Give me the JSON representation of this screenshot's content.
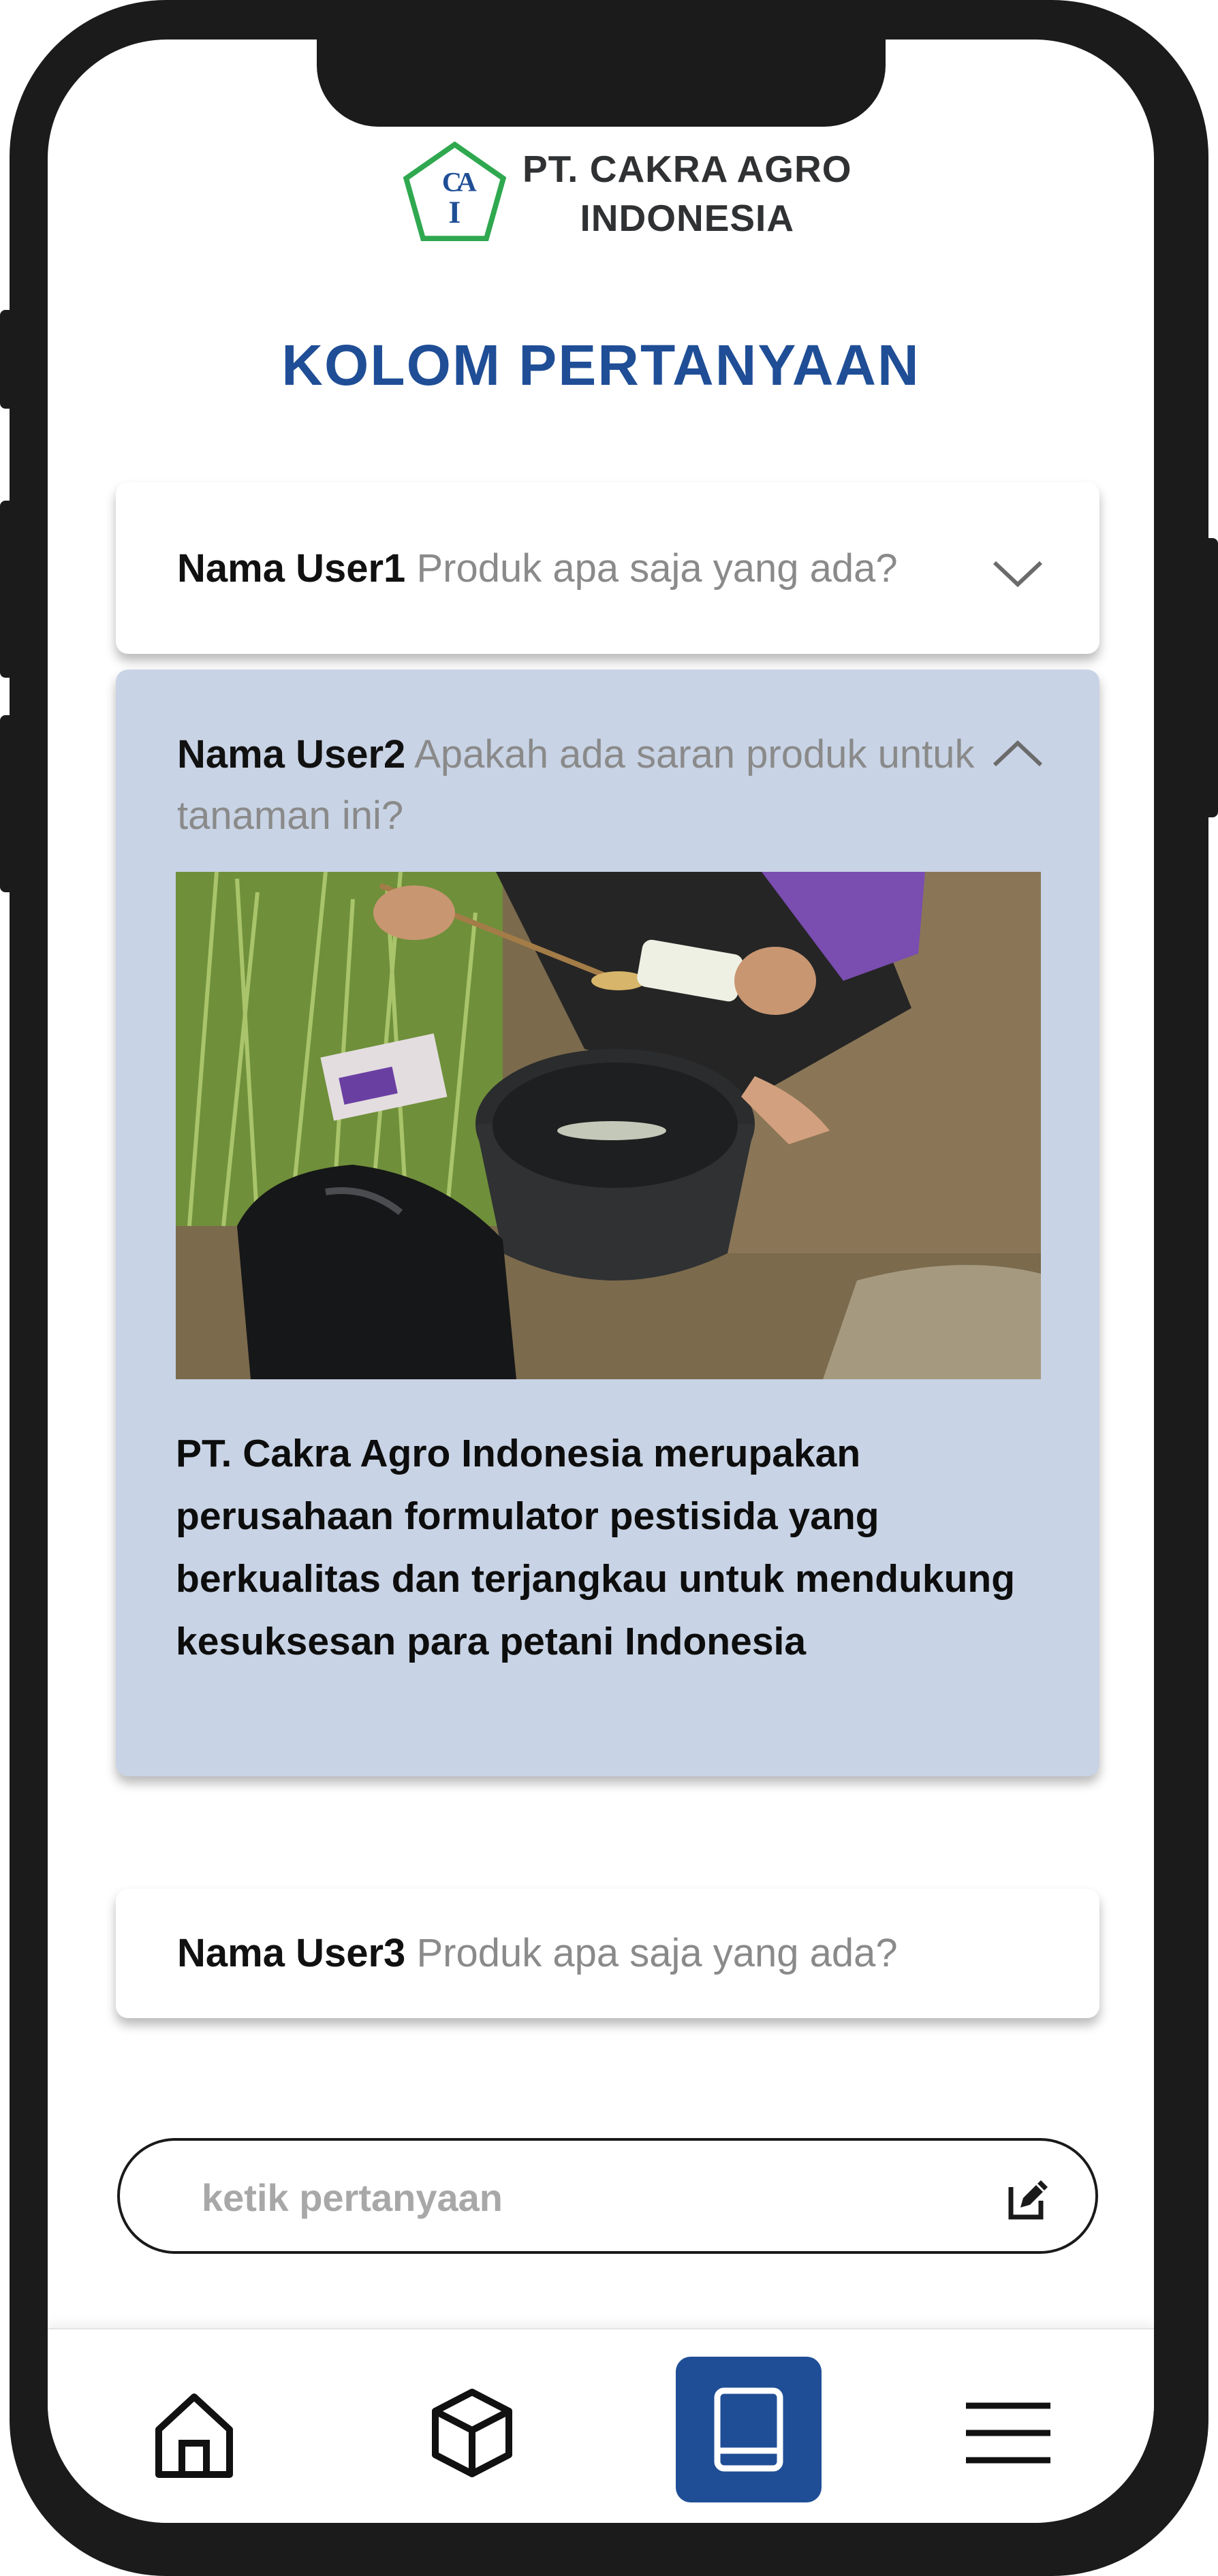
{
  "brand": {
    "name_line1": "PT. CAKRA AGRO",
    "name_line2": "INDONESIA",
    "logo_text": "CAI",
    "logo_color": "#2fa84f"
  },
  "page": {
    "title": "KOLOM PERTANYAAN",
    "title_color": "#1f4e96"
  },
  "questions": [
    {
      "user": "Nama User1",
      "text": "Produk apa saja yang ada?",
      "expanded": false,
      "chevron_icon": "chevron-down-icon"
    },
    {
      "user": "Nama User2",
      "text": "Apakah ada saran produk untuk tanaman ini?",
      "expanded": true,
      "chevron_icon": "chevron-up-icon",
      "photo_icon": "farmer-mixing-pesticide-photo",
      "answer": "PT. Cakra Agro Indonesia merupakan perusahaan formulator pestisida yang berkualitas dan terjangkau untuk mendukung kesuksesan para petani Indonesia"
    },
    {
      "user": "Nama User3",
      "text": "Produk apa saja yang ada?",
      "expanded": false
    }
  ],
  "ask_input": {
    "placeholder": "ketik pertanyaan",
    "value": "",
    "icon": "edit-icon"
  },
  "nav": {
    "items": [
      {
        "icon": "home-icon",
        "active": false
      },
      {
        "icon": "box-icon",
        "active": false
      },
      {
        "icon": "book-icon",
        "active": true
      },
      {
        "icon": "menu-icon",
        "active": false
      }
    ],
    "active_color": "#1f4e96"
  },
  "colors": {
    "expanded_card_bg": "#c8d3e5",
    "frame": "#1b1b1b"
  }
}
